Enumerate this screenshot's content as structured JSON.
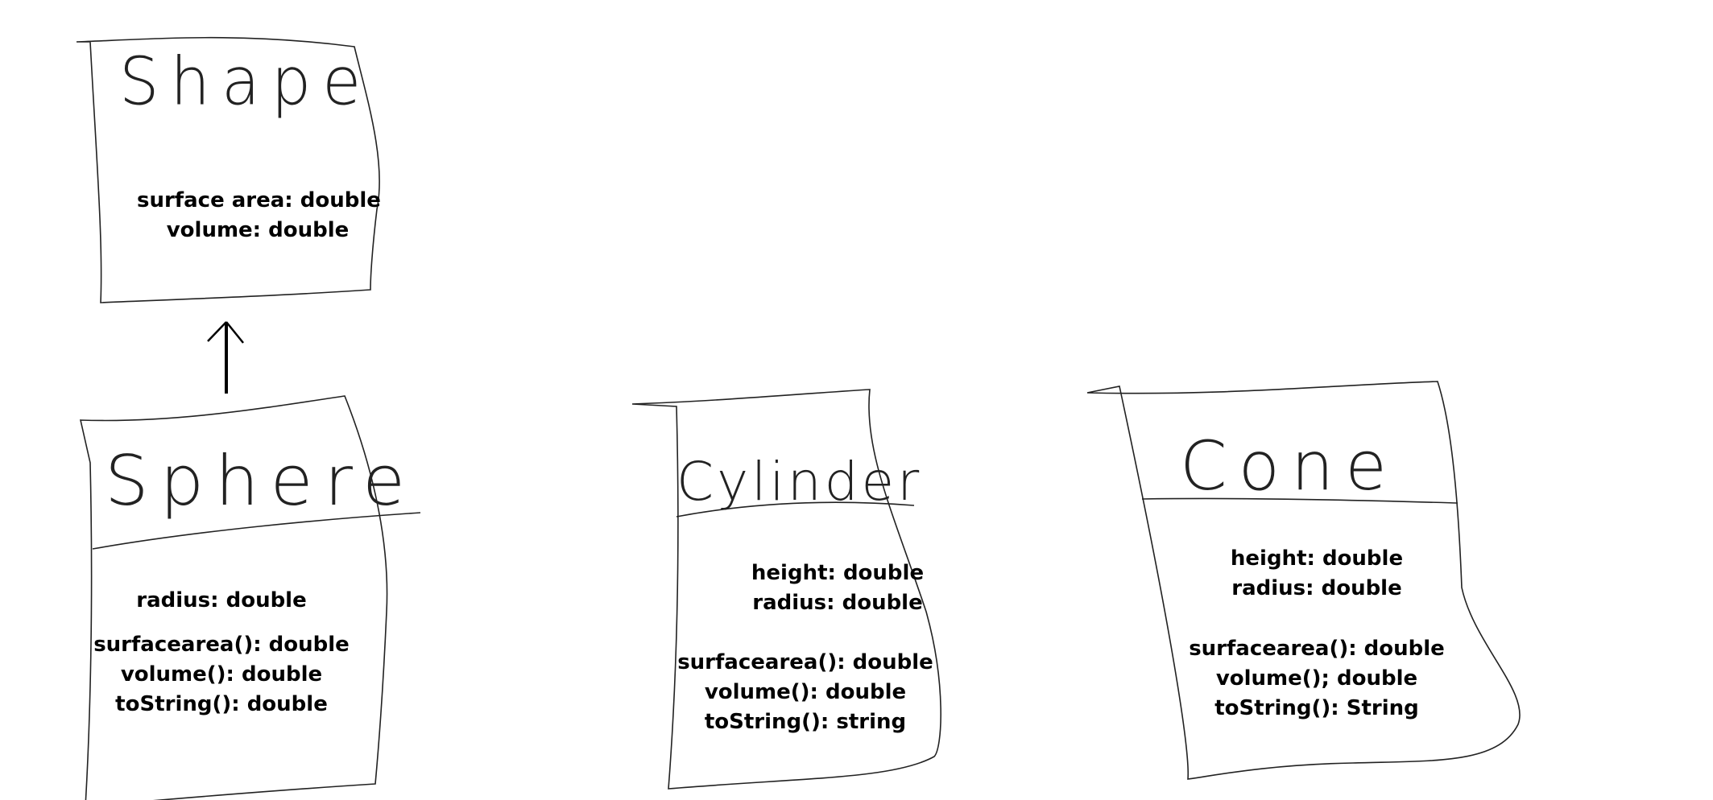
{
  "classes": [
    {
      "name": "Shape",
      "attributes": [
        "surface area: double",
        "volume: double"
      ],
      "methods": []
    },
    {
      "name": "Sphere",
      "attributes": [
        "radius: double"
      ],
      "methods": [
        "surfacearea(): double",
        "volume(): double",
        "toString(): double"
      ]
    },
    {
      "name": "Cylinder",
      "attributes": [
        "height: double",
        "radius: double"
      ],
      "methods": [
        "surfacearea(): double",
        "volume(): double",
        "toString(): string"
      ]
    },
    {
      "name": "Cone",
      "attributes": [
        "height: double",
        "radius: double"
      ],
      "methods": [
        "surfacearea(): double",
        "volume(); double",
        "toString(): String"
      ]
    }
  ],
  "relations": [
    {
      "type": "inheritance",
      "from": "Sphere",
      "to": "Shape"
    }
  ],
  "colors": {
    "ink": "#000000",
    "background": "#ffffff"
  }
}
